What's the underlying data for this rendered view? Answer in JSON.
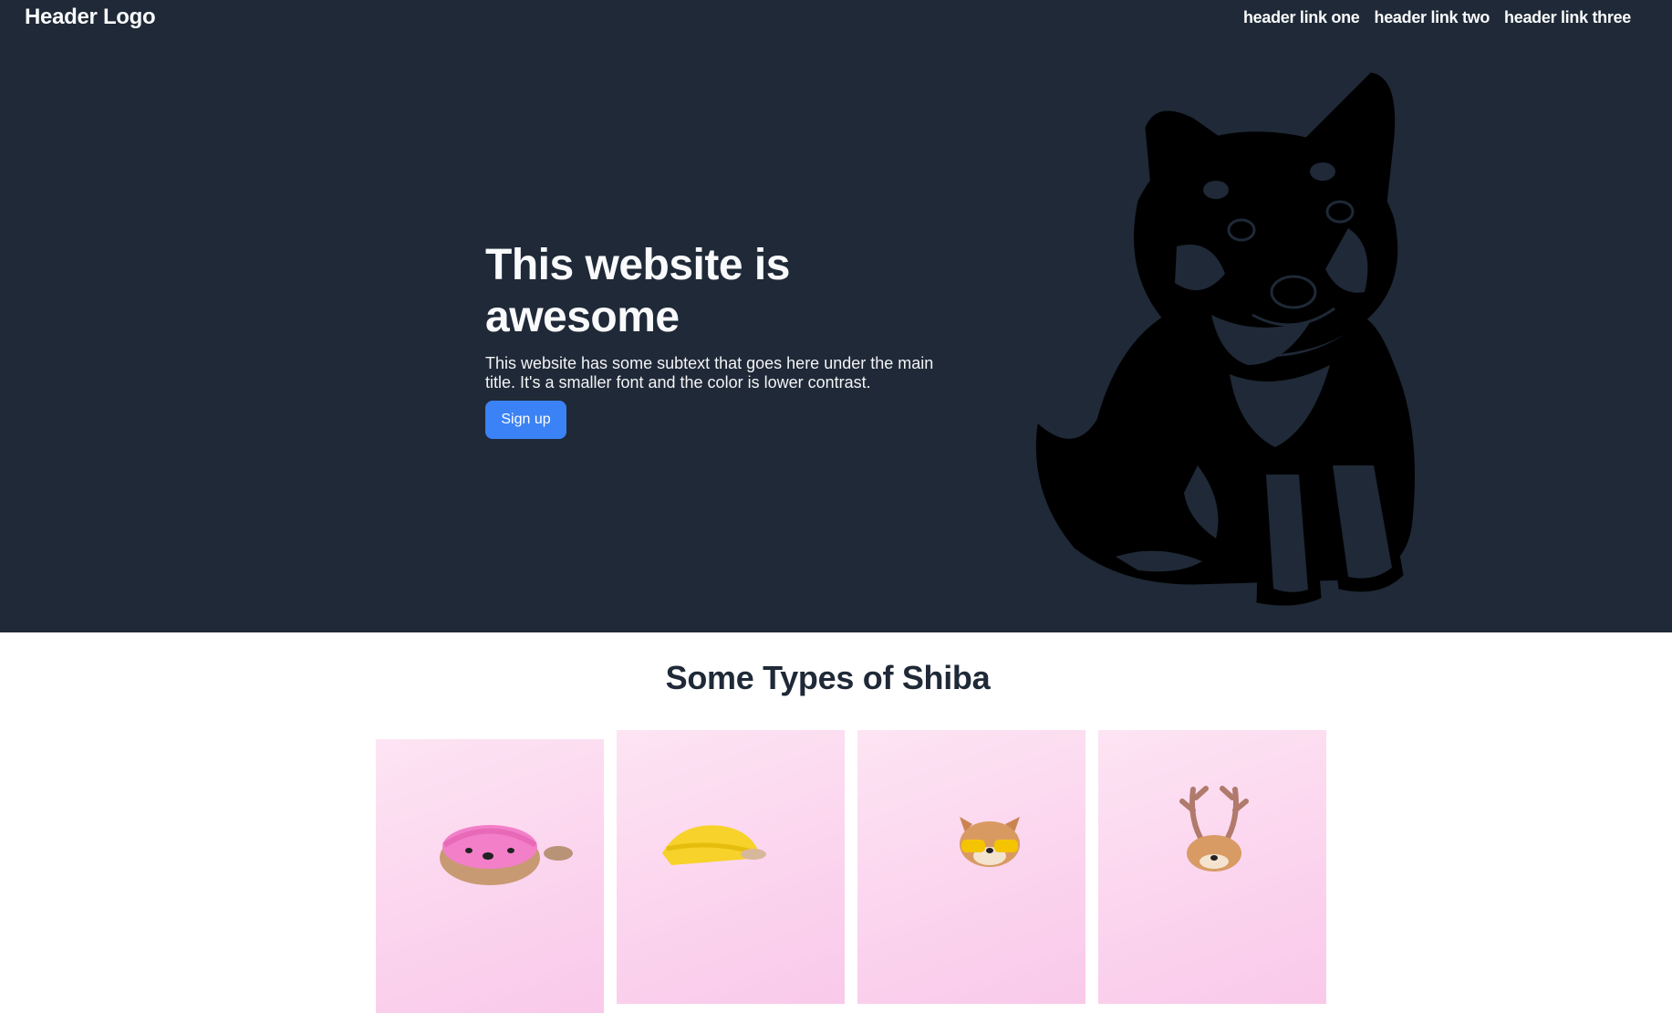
{
  "header": {
    "logo": "Header Logo",
    "links": [
      "header link one",
      "header link two",
      "header link three"
    ]
  },
  "hero": {
    "title": "This website is awesome",
    "subtitle": "This website has some subtext that goes here under the main title. It's a smaller font and the color is lower contrast.",
    "cta_label": "Sign up",
    "illustration": "shiba-puppy-silhouette"
  },
  "section": {
    "title": "Some Types of Shiba",
    "cards": [
      {
        "image": "shiba-with-pink-shower-cap"
      },
      {
        "image": "shiba-with-yellow-beanie"
      },
      {
        "image": "shiba-with-yellow-glasses"
      },
      {
        "image": "shiba-with-reindeer-antlers"
      }
    ]
  },
  "colors": {
    "hero_bg": "#1f2937",
    "accent": "#3b82f6",
    "card_bg": "#fbd3ee",
    "text_light": "#f9fafb",
    "text_dark": "#1f2937"
  }
}
